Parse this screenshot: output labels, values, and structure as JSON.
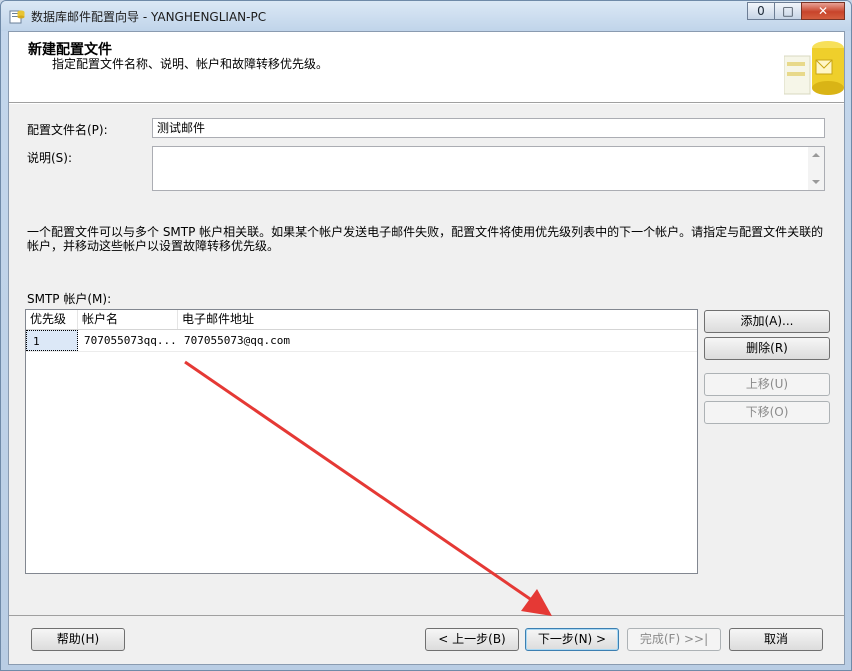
{
  "window": {
    "title": "数据库邮件配置向导 - YANGHENGLIAN-PC",
    "minimize_glyph": "0",
    "maximize_glyph": "□",
    "close_glyph": "✕"
  },
  "header": {
    "title": "新建配置文件",
    "subtitle": "指定配置文件名称、说明、帐户和故障转移优先级。"
  },
  "form": {
    "profile_name_label": "配置文件名(P):",
    "profile_name_value": "测试邮件",
    "description_label": "说明(S):",
    "description_value": ""
  },
  "info_text": "一个配置文件可以与多个 SMTP 帐户相关联。如果某个帐户发送电子邮件失败，配置文件将使用优先级列表中的下一个帐户。请指定与配置文件关联的帐户，并移动这些帐户以设置故障转移优先级。",
  "accounts": {
    "label": "SMTP 帐户(M):",
    "columns": [
      "优先级",
      "帐户名",
      "电子邮件地址"
    ],
    "rows": [
      {
        "priority": "1",
        "account": "707055073qq...",
        "email": "707055073@qq.com"
      }
    ]
  },
  "side_buttons": {
    "add": "添加(A)...",
    "remove": "删除(R)",
    "move_up": "上移(U)",
    "move_down": "下移(O)"
  },
  "footer": {
    "help": "帮助(H)",
    "back": "< 上一步(B)",
    "next": "下一步(N) >",
    "finish": "完成(F) >>|",
    "cancel": "取消"
  },
  "colors": {
    "annotation_arrow": "#e53935",
    "client_bg": "#f0f0f0",
    "close_button": "#c8442b"
  }
}
